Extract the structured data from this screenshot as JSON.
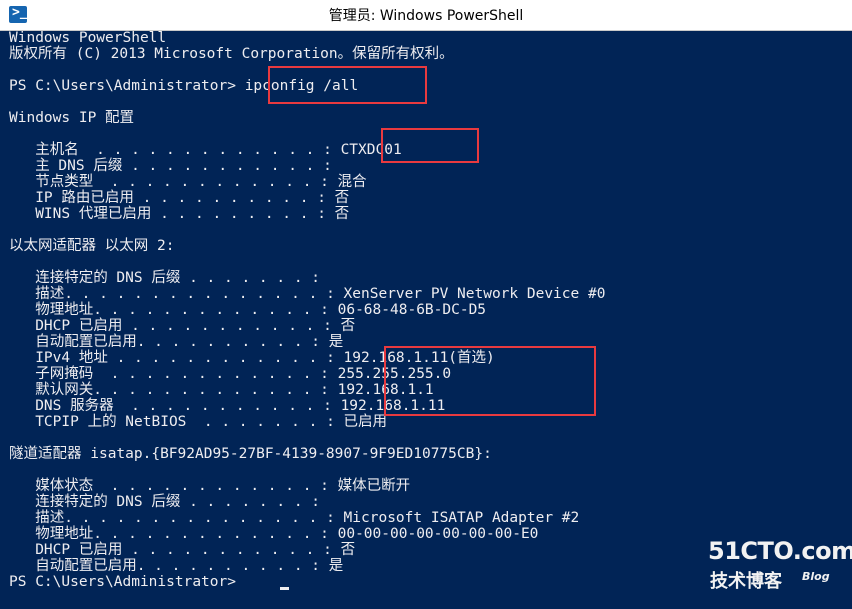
{
  "window": {
    "title": "管理员: Windows PowerShell",
    "icon": "powershell-icon",
    "icon_glyph": ">_"
  },
  "console": {
    "lines": [
      {
        "id": "banner",
        "text": "Windows PowerShell"
      },
      {
        "id": "copyright",
        "text": "版权所有 (C) 2013 Microsoft Corporation。保留所有权利。"
      },
      {
        "id": "blank1",
        "text": ""
      },
      {
        "id": "prompt-1",
        "text": "PS C:\\Users\\Administrator> ipconfig /all"
      },
      {
        "id": "blank2",
        "text": ""
      },
      {
        "id": "ip-config-header",
        "text": "Windows IP 配置"
      },
      {
        "id": "blank3",
        "text": ""
      },
      {
        "id": "host-name",
        "text": "   主机名  . . . . . . . . . . . . . : CTXDC01"
      },
      {
        "id": "primary-dns-suffix",
        "text": "   主 DNS 后缀 . . . . . . . . . . . :"
      },
      {
        "id": "node-type",
        "text": "   节点类型  . . . . . . . . . . . . : 混合"
      },
      {
        "id": "ip-routing",
        "text": "   IP 路由已启用 . . . . . . . . . . : 否"
      },
      {
        "id": "wins-proxy",
        "text": "   WINS 代理已启用 . . . . . . . . . : 否"
      },
      {
        "id": "blank4",
        "text": ""
      },
      {
        "id": "ethernet-adapter-header",
        "text": "以太网适配器 以太网 2:"
      },
      {
        "id": "blank5",
        "text": ""
      },
      {
        "id": "eth-dns-suffix",
        "text": "   连接特定的 DNS 后缀 . . . . . . . :"
      },
      {
        "id": "eth-description",
        "text": "   描述. . . . . . . . . . . . . . . : XenServer PV Network Device #0"
      },
      {
        "id": "eth-physical-address",
        "text": "   物理地址. . . . . . . . . . . . . : 06-68-48-6B-DC-D5"
      },
      {
        "id": "eth-dhcp",
        "text": "   DHCP 已启用 . . . . . . . . . . . : 否"
      },
      {
        "id": "eth-autoconfig",
        "text": "   自动配置已启用. . . . . . . . . . : 是"
      },
      {
        "id": "eth-ipv4",
        "text": "   IPv4 地址 . . . . . . . . . . . . : 192.168.1.11(首选)"
      },
      {
        "id": "eth-subnet-mask",
        "text": "   子网掩码  . . . . . . . . . . . . : 255.255.255.0"
      },
      {
        "id": "eth-default-gateway",
        "text": "   默认网关. . . . . . . . . . . . . : 192.168.1.1"
      },
      {
        "id": "eth-dns-servers",
        "text": "   DNS 服务器  . . . . . . . . . . . : 192.168.1.11"
      },
      {
        "id": "eth-netbios",
        "text": "   TCPIP 上的 NetBIOS  . . . . . . . : 已启用"
      },
      {
        "id": "blank6",
        "text": ""
      },
      {
        "id": "tunnel-adapter-header",
        "text": "隧道适配器 isatap.{BF92AD95-27BF-4139-8907-9F9ED10775CB}:"
      },
      {
        "id": "blank7",
        "text": ""
      },
      {
        "id": "tun-media-state",
        "text": "   媒体状态  . . . . . . . . . . . . : 媒体已断开"
      },
      {
        "id": "tun-dns-suffix",
        "text": "   连接特定的 DNS 后缀 . . . . . . . :"
      },
      {
        "id": "tun-description",
        "text": "   描述. . . . . . . . . . . . . . . : Microsoft ISATAP Adapter #2"
      },
      {
        "id": "tun-physical-address",
        "text": "   物理地址. . . . . . . . . . . . . : 00-00-00-00-00-00-00-E0"
      },
      {
        "id": "tun-dhcp",
        "text": "   DHCP 已启用 . . . . . . . . . . . : 否"
      },
      {
        "id": "tun-autoconfig",
        "text": "   自动配置已启用. . . . . . . . . . : 是"
      },
      {
        "id": "prompt-2",
        "text": "PS C:\\Users\\Administrator> "
      }
    ]
  },
  "colors": {
    "background": "#012456",
    "foreground": "#eeedf0",
    "highlight": "#e83a3f"
  },
  "watermark": {
    "main": "51CTO.com",
    "sub": "技术博客",
    "blog": "Blog"
  }
}
